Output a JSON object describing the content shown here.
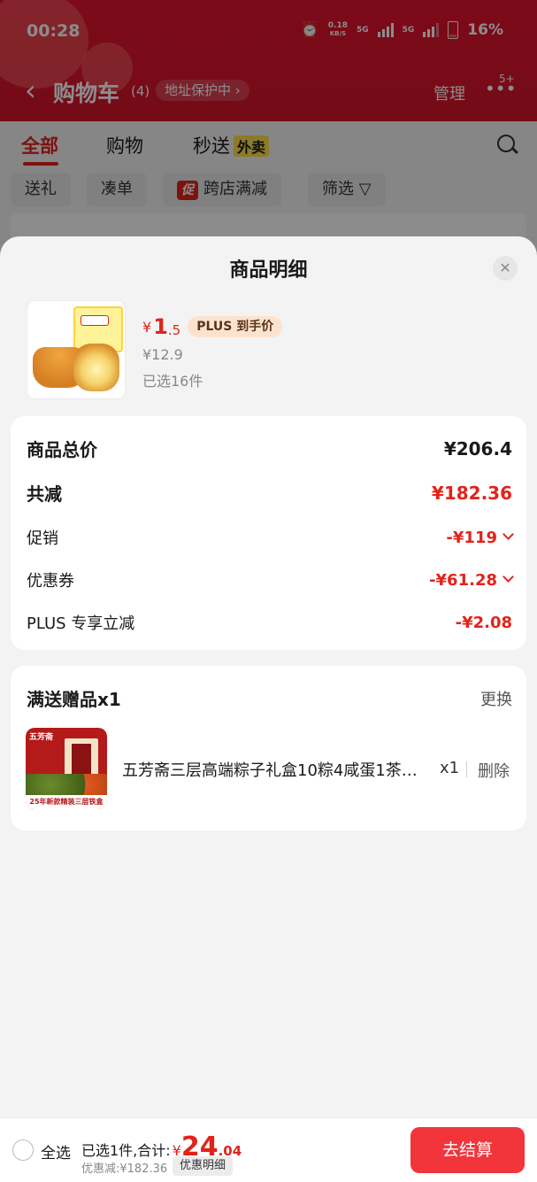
{
  "status": {
    "time": "00:28",
    "net_speed": "0.18",
    "net_unit": "KB/S",
    "sig1": "5G",
    "sig2": "5G",
    "battery": "16%"
  },
  "header": {
    "back": "‹",
    "title": "购物车",
    "count": "(4)",
    "addr": "地址保护中 ›",
    "manage": "管理",
    "more": "•••",
    "badge": "5+"
  },
  "tabs": [
    {
      "label": "全部"
    },
    {
      "label": "购物"
    },
    {
      "label": "秒送",
      "tag": "外卖"
    }
  ],
  "chips": [
    {
      "label": "送礼"
    },
    {
      "label": "凑单"
    },
    {
      "label": "跨店满减",
      "tag": "促"
    },
    {
      "label": "筛选 ▽"
    }
  ],
  "sheet": {
    "title": "商品明细",
    "close": "✕",
    "product": {
      "yen": "¥",
      "price_int": "1",
      "price_dec": ".5",
      "plus_tag": "PLUS 到手价",
      "original": "¥12.9",
      "selected": "已选16件"
    },
    "summary": {
      "total_label": "商品总价",
      "total_value": "¥206.4",
      "reduce_label": "共减",
      "reduce_value": "¥182.36",
      "promo_label": "促销",
      "promo_value": "-¥119",
      "coupon_label": "优惠券",
      "coupon_value": "-¥61.28",
      "plus_label": "PLUS 专享立减",
      "plus_value": "-¥2.08"
    },
    "gift": {
      "title": "满送赠品x1",
      "change": "更换",
      "name": "五芳斋三层高端粽子礼盒10粽4咸蛋1茶…",
      "qty": "x1",
      "delete": "删除",
      "img_brand": "五芳斋",
      "img_band": "25年新款精装三层铁盒"
    }
  },
  "bottom": {
    "select_all": "全选",
    "selected_text": "已选1件,合计:",
    "yen": "¥",
    "total_int": "24",
    "total_dec": ".04",
    "discount": "优惠减:¥182.36",
    "detail_btn": "优惠明细",
    "checkout": "去结算"
  }
}
